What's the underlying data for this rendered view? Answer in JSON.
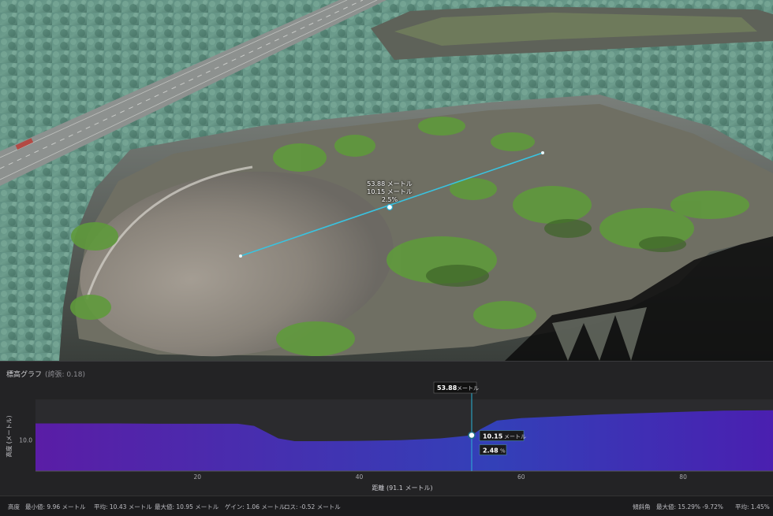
{
  "scene": {
    "measurement": {
      "distance": "53.88 メートル",
      "height": "10.15 メートル",
      "slope": "2.5%"
    }
  },
  "panel": {
    "title": "標高グラフ",
    "subtitle": "(誇張: 0.18)"
  },
  "chart_data": {
    "type": "area",
    "title": "標高グラフ",
    "xlabel": "距離 (91.1 メートル)",
    "ylabel": "高度 (メートル)",
    "x_ticks": [
      20,
      40,
      60,
      80
    ],
    "y_ticks": [
      10.0
    ],
    "xlim": [
      0,
      91.1
    ],
    "ylim": [
      9.0,
      11.3
    ],
    "x": [
      0,
      5,
      10,
      15,
      20,
      25,
      27,
      30,
      32,
      35,
      40,
      45,
      50,
      52,
      53.88,
      55,
      57,
      60,
      65,
      70,
      75,
      80,
      85,
      91.1
    ],
    "y": [
      10.53,
      10.53,
      10.53,
      10.52,
      10.52,
      10.52,
      10.45,
      10.05,
      9.96,
      9.96,
      9.97,
      9.99,
      10.05,
      10.1,
      10.15,
      10.35,
      10.62,
      10.7,
      10.76,
      10.82,
      10.86,
      10.9,
      10.94,
      10.95
    ],
    "cursor": {
      "distance": "53.88",
      "distance_unit": "メートル",
      "height": "10.15",
      "height_unit": "メートル",
      "slope": "2.48",
      "slope_unit": "%"
    }
  },
  "footer": {
    "label_elevation": "高度",
    "min": "最小値: 9.96 メートル",
    "avg": "平均: 10.43 メートル",
    "max": "最大値: 10.95 メートル",
    "gain": "ゲイン: 1.06 メートル",
    "loss": "ロス: -0.52 メートル",
    "label_slope": "傾斜角",
    "slope_max": "最大値: 15.29% -9.72%",
    "slope_avg": "平均: 1.45%"
  },
  "colors": {
    "profile_left": "#5a1da6",
    "profile_mid": "#3340b8",
    "profile_right": "#4a1fb0",
    "cursor": "#2ab3d6"
  }
}
